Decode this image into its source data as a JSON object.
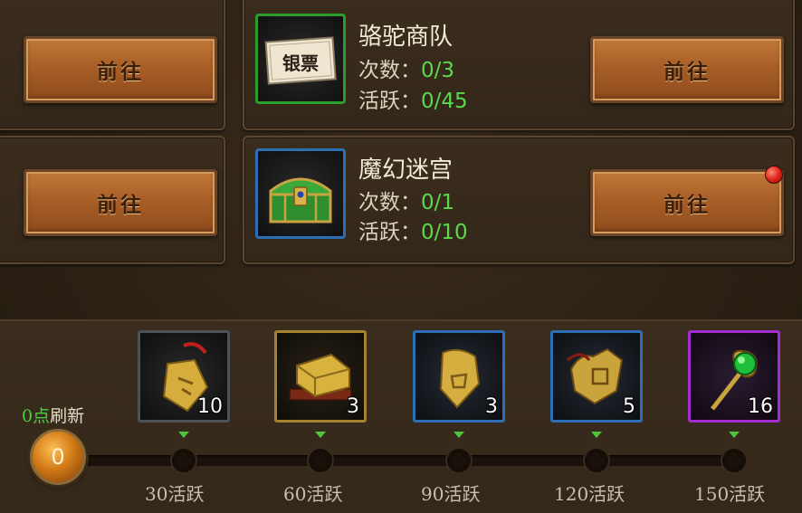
{
  "rows": [
    {
      "left_button_label": "前往",
      "title": "骆驼商队",
      "icon": "silver-note-icon",
      "icon_text": "银票",
      "count_label": "次数：",
      "count_value": "0/3",
      "active_label": "活跃：",
      "active_value": "0/45",
      "button_label": "前往"
    },
    {
      "left_button_label": "前往",
      "title": "魔幻迷宫",
      "icon": "treasure-chest-icon",
      "count_label": "次数：",
      "count_value": "0/1",
      "active_label": "活跃：",
      "active_value": "0/10",
      "button_label": "前往"
    }
  ],
  "refresh": {
    "points": "0点",
    "label": "刷新"
  },
  "activity_value": "0",
  "rewards": [
    {
      "icon": "pendant-token-icon",
      "count": "10",
      "milestone": "30活跃",
      "rarity": "grey"
    },
    {
      "icon": "golden-box-icon",
      "count": "3",
      "milestone": "60活跃",
      "rarity": "gold"
    },
    {
      "icon": "gold-tablet-icon",
      "count": "3",
      "milestone": "90活跃",
      "rarity": "blue"
    },
    {
      "icon": "gold-emblem-icon",
      "count": "5",
      "milestone": "120活跃",
      "rarity": "blue"
    },
    {
      "icon": "jade-scepter-icon",
      "count": "16",
      "milestone": "150活跃",
      "rarity": "purple"
    }
  ],
  "colors": {
    "green_value": "#5ad94a",
    "accent_button": "#a85f27",
    "notification": "#e3241a"
  }
}
